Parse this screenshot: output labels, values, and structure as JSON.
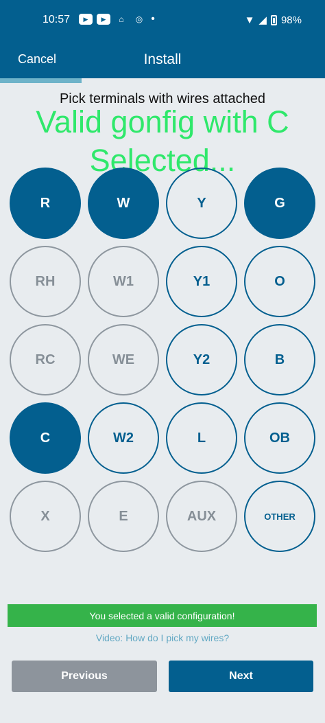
{
  "status_bar": {
    "time": "10:57",
    "battery": "98%",
    "left_icons": [
      "youtube-icon",
      "youtube-icon",
      "playstation-icon",
      "instagram-icon",
      "dot-icon"
    ],
    "right_icons": [
      "wifi-icon",
      "signal-icon",
      "battery-icon"
    ]
  },
  "nav": {
    "cancel_label": "Cancel",
    "title": "Install"
  },
  "progress": {
    "fraction": 0.25
  },
  "prompt": "Pick terminals with wires attached",
  "overlay_text": {
    "line1": "Valid gonfig with C",
    "line2": "Selected..."
  },
  "terminals": [
    {
      "label": "R",
      "state": "selected"
    },
    {
      "label": "W",
      "state": "selected"
    },
    {
      "label": "Y",
      "state": "available"
    },
    {
      "label": "G",
      "state": "selected"
    },
    {
      "label": "RH",
      "state": "disabled"
    },
    {
      "label": "W1",
      "state": "disabled"
    },
    {
      "label": "Y1",
      "state": "available"
    },
    {
      "label": "O",
      "state": "available"
    },
    {
      "label": "RC",
      "state": "disabled"
    },
    {
      "label": "WE",
      "state": "disabled"
    },
    {
      "label": "Y2",
      "state": "available"
    },
    {
      "label": "B",
      "state": "available"
    },
    {
      "label": "C",
      "state": "selected"
    },
    {
      "label": "W2",
      "state": "available"
    },
    {
      "label": "L",
      "state": "available"
    },
    {
      "label": "OB",
      "state": "available"
    },
    {
      "label": "X",
      "state": "disabled"
    },
    {
      "label": "E",
      "state": "disabled"
    },
    {
      "label": "AUX",
      "state": "disabled"
    },
    {
      "label": "OTHER",
      "state": "available"
    }
  ],
  "banner": "You selected a valid configuration!",
  "video_link": "Video: How do I pick my wires?",
  "buttons": {
    "previous": "Previous",
    "next": "Next"
  },
  "colors": {
    "primary": "#035f8f",
    "success": "#35b34a",
    "overlay": "#2fe86b",
    "disabled": "#8e979f",
    "link": "#62a8c3"
  }
}
